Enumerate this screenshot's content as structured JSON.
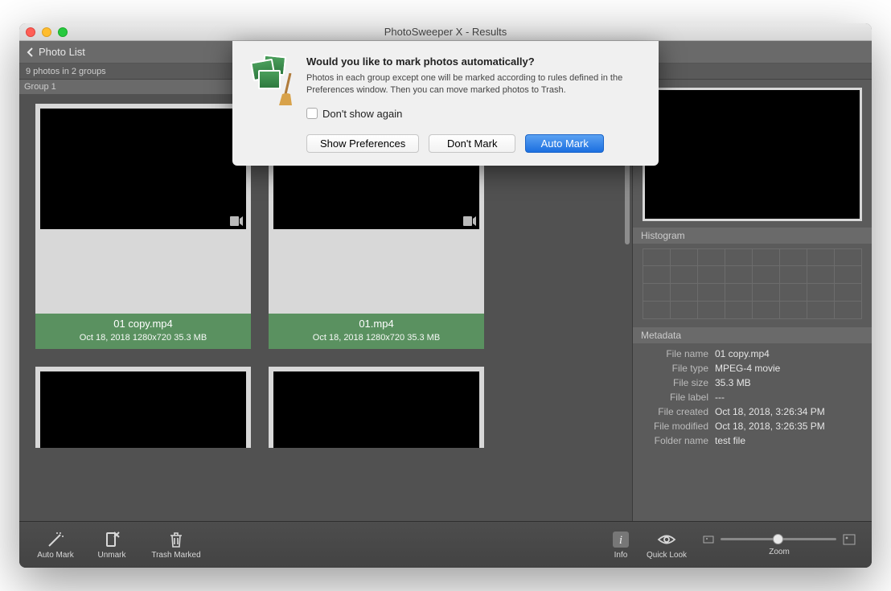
{
  "window": {
    "title": "PhotoSweeper X - Results"
  },
  "nav": {
    "back_label": "Photo List"
  },
  "status": {
    "summary": "9 photos in 2 groups"
  },
  "group": {
    "header": "Group 1"
  },
  "thumbs": [
    {
      "title": "01 copy.mp4",
      "meta": "Oct 18, 2018   1280x720   35.3 MB"
    },
    {
      "title": "01.mp4",
      "meta": "Oct 18, 2018   1280x720   35.3 MB"
    }
  ],
  "sidebar": {
    "histogram_title": "Histogram",
    "metadata_title": "Metadata",
    "metadata": [
      {
        "k": "File name",
        "v": "01 copy.mp4"
      },
      {
        "k": "File type",
        "v": "MPEG-4 movie"
      },
      {
        "k": "File size",
        "v": "35.3 MB"
      },
      {
        "k": "File label",
        "v": "---"
      },
      {
        "k": "File created",
        "v": "Oct 18, 2018, 3:26:34 PM"
      },
      {
        "k": "File modified",
        "v": "Oct 18, 2018, 3:26:35 PM"
      },
      {
        "k": "Folder name",
        "v": "test file"
      }
    ]
  },
  "toolbar": {
    "auto_mark": "Auto Mark",
    "unmark": "Unmark",
    "trash_marked": "Trash Marked",
    "info": "Info",
    "quick_look": "Quick Look",
    "zoom": "Zoom"
  },
  "dialog": {
    "title": "Would you like to mark photos automatically?",
    "body": "Photos in each group except one will be marked according to rules defined in the Preferences window. Then you can move marked photos to Trash.",
    "checkbox_label": "Don't show again",
    "show_preferences": "Show Preferences",
    "dont_mark": "Don't Mark",
    "auto_mark": "Auto Mark"
  }
}
